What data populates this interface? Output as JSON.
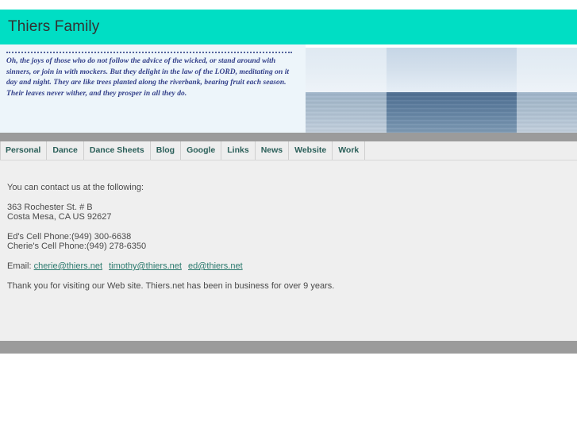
{
  "site": {
    "title": "Thiers Family"
  },
  "quote": {
    "text": "Oh, the joys of those who do not follow the advice of the wicked, or stand around with sinners, or join in with mockers. But they delight in the law of the LORD, meditating on it day and night. They are like trees planted along the riverbank, bearing fruit each season. Their leaves never wither, and they prosper in all they do."
  },
  "nav": {
    "items": [
      {
        "label": "Personal"
      },
      {
        "label": "Dance"
      },
      {
        "label": "Dance Sheets"
      },
      {
        "label": "Blog"
      },
      {
        "label": "Google"
      },
      {
        "label": "Links"
      },
      {
        "label": "News"
      },
      {
        "label": "Website"
      },
      {
        "label": "Work"
      }
    ]
  },
  "content": {
    "intro": "You can contact us at the following:",
    "address_line1": "363 Rochester St. # B",
    "address_line2": "Costa Mesa, CA US 92627",
    "phone_ed": "Ed's Cell Phone:(949) 300-6638",
    "phone_cherie": "Cherie's Cell Phone:(949) 278-6350",
    "email_label": "Email:",
    "emails": [
      {
        "address": "cherie@thiers.net"
      },
      {
        "address": "timothy@thiers.net"
      },
      {
        "address": "ed@thiers.net"
      }
    ],
    "closing": "Thank you for visiting our Web site. Thiers.net has been in business for over 9 years."
  },
  "colors": {
    "header_teal": "#00dec4",
    "quote_bg": "#edf5fa",
    "quote_text": "#33408a",
    "nav_text": "#2b5f59",
    "link_teal": "#2b7a6e",
    "content_bg": "#efefef",
    "divider_gray": "#9b9b9b"
  },
  "banner": {
    "photos": [
      {
        "name": "ocean-horizon-left"
      },
      {
        "name": "ocean-horizon-center"
      },
      {
        "name": "ocean-horizon-right"
      }
    ]
  }
}
